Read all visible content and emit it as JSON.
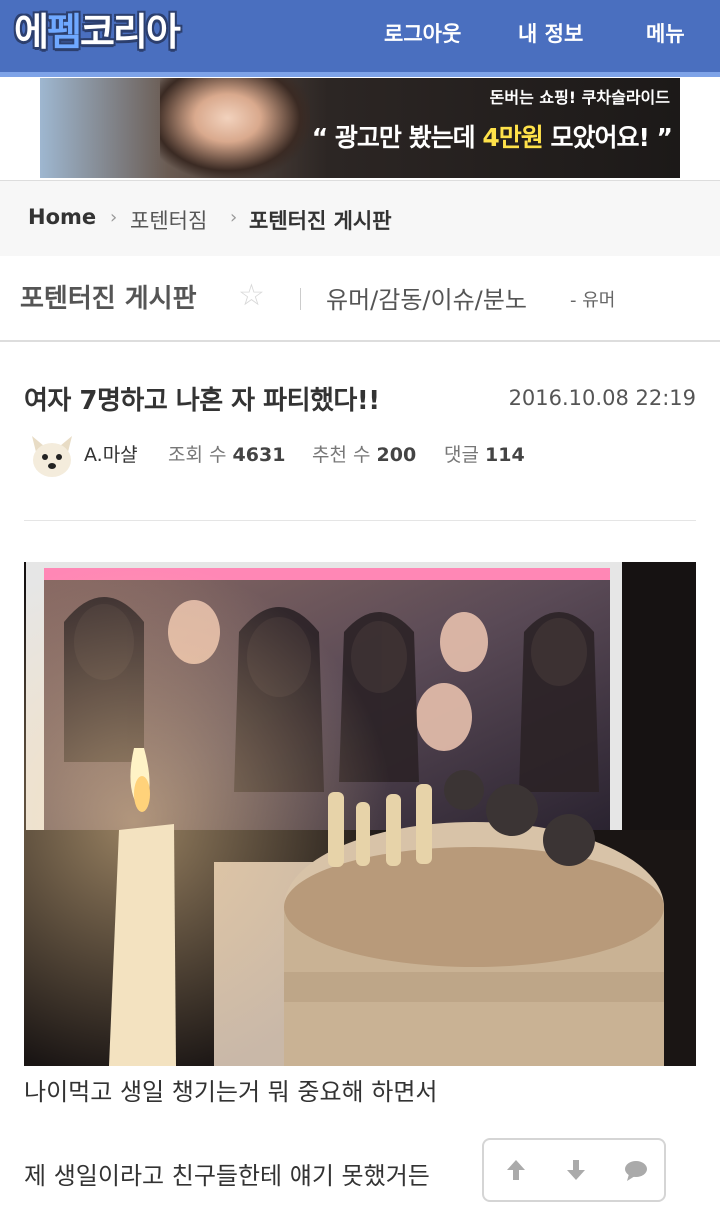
{
  "header": {
    "logo": {
      "part1": "에",
      "part2": "펨",
      "part3": "코리아"
    },
    "nav": {
      "logout": "로그아웃",
      "my_info": "내 정보",
      "menu": "메뉴"
    }
  },
  "ad": {
    "top_text": "돈버는 쇼핑! 쿠차슬라이드",
    "main_prefix": "“ 광고만 봤는데 ",
    "main_highlight": "4만원",
    "main_suffix": " 모았어요! ”"
  },
  "breadcrumb": {
    "home": "Home",
    "level1": "포텐터짐",
    "level2": "포텐터진 게시판"
  },
  "board": {
    "title": "포텐터진 게시판",
    "category": "유머/감동/이슈/분노",
    "subcategory": "- 유머"
  },
  "post": {
    "title": "여자 7명하고 나혼 자 파티했다!!",
    "date": "2016.10.08 22:19",
    "author": "A.마샬",
    "views_label": "조회 수",
    "views": "4631",
    "likes_label": "추천 수",
    "likes": "200",
    "comments_label": "댓글",
    "comments": "114",
    "body": [
      "나이먹고 생일 챙기는거 뭐 중요해 하면서",
      "제 생일이라고 친구들한테 얘기 못했거든"
    ]
  },
  "colors": {
    "header_bg": "#4a6fbf",
    "header_line": "#7ea3e8",
    "ad_highlight": "#ffe24a"
  },
  "icons": [
    "star-icon",
    "arrow-up-icon",
    "arrow-down-icon",
    "comment-icon",
    "chevron-right-icon"
  ]
}
